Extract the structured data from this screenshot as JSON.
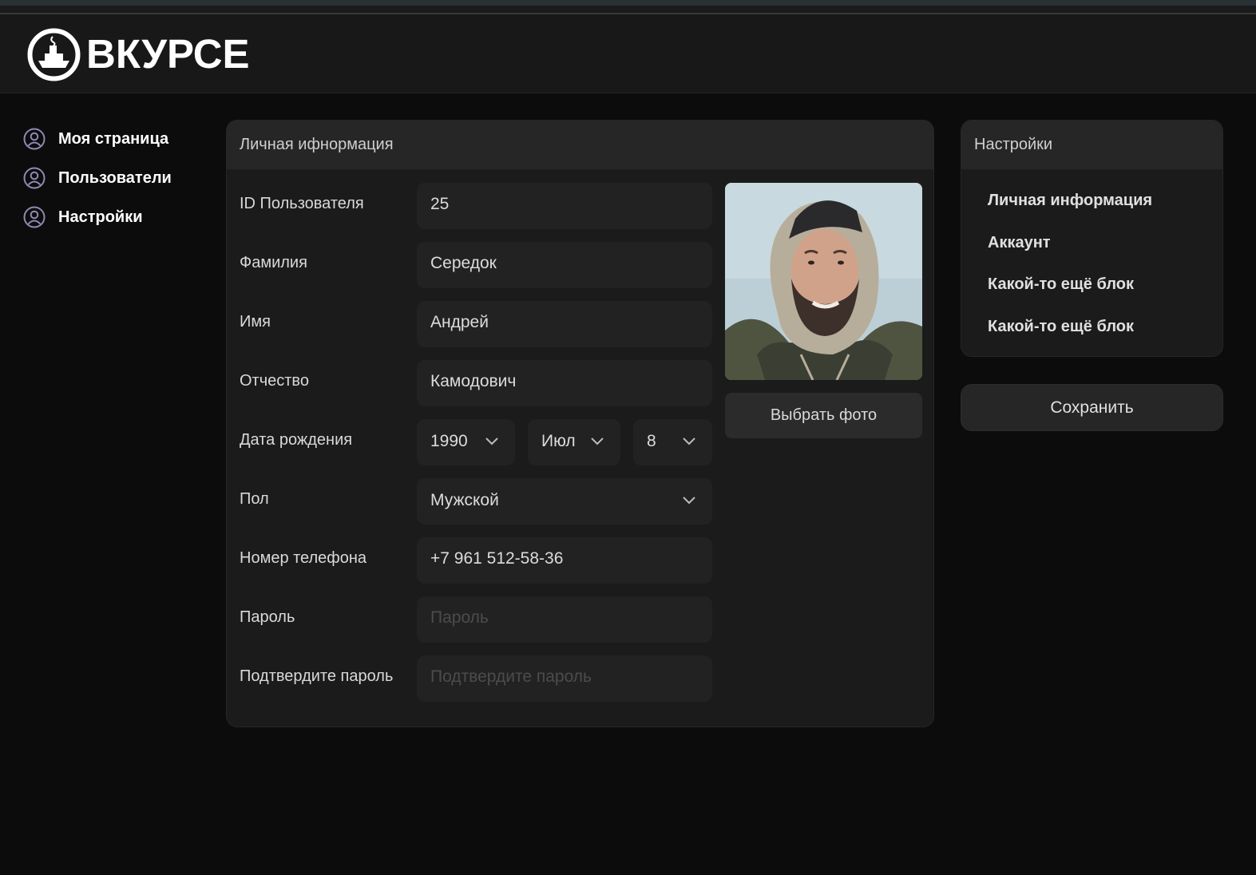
{
  "brand": {
    "name": "ВКУРСЕ",
    "logo_icon": "ship-icon"
  },
  "nav": [
    {
      "label": "Моя страница",
      "icon": "user-circle-icon"
    },
    {
      "label": "Пользователи",
      "icon": "user-circle-icon"
    },
    {
      "label": "Настройки",
      "icon": "user-circle-icon"
    }
  ],
  "personal": {
    "title": "Личная ифнормация",
    "fields": {
      "id": {
        "label": "ID Пользователя",
        "value": "25"
      },
      "last_name": {
        "label": "Фамилия",
        "value": "Середок"
      },
      "first_name": {
        "label": "Имя",
        "value": "Андрей"
      },
      "patronymic": {
        "label": "Отчество",
        "value": "Камодович"
      },
      "birth": {
        "label": "Дата рождения",
        "year": "1990",
        "month": "Июл",
        "day": "8"
      },
      "gender": {
        "label": "Пол",
        "value": "Мужской"
      },
      "phone": {
        "label": "Номер телефона",
        "value": "+7 961 512-58-36"
      },
      "password": {
        "label": "Пароль",
        "placeholder": "Пароль"
      },
      "password_confirm": {
        "label": "Подтвердите пароль",
        "placeholder": "Подтвердите пароль"
      }
    },
    "photo_button": "Выбрать фото"
  },
  "settings": {
    "title": "Настройки",
    "items": [
      "Личная информация",
      "Аккаунт",
      "Какой-то ещё блок",
      "Какой-то ещё блок"
    ],
    "save_label": "Сохранить"
  },
  "colors": {
    "background": "#0c0c0c",
    "header": "#181818",
    "card": "#1b1b1b",
    "card_head": "#262626",
    "field": "#222222",
    "nav_icon": "#8e8ab5"
  }
}
